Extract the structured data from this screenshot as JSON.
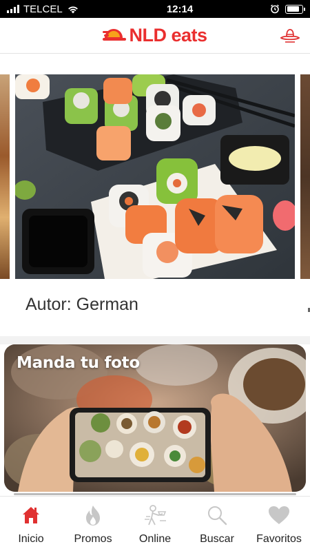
{
  "status_bar": {
    "carrier": "TELCEL",
    "time": "12:14",
    "battery_level": 0.85
  },
  "header": {
    "logo_text": "NLD eats",
    "brand_color": "#ea2f2f",
    "menu_icon": "sombrero-icon"
  },
  "feed": {
    "slide_image": "sushi-platter-photo",
    "author_label": "Autor: German"
  },
  "promo_card": {
    "title": "Manda tu foto",
    "image": "phone-photographing-food-photo"
  },
  "bottom_nav": {
    "active_color": "#e03131",
    "inactive_color": "#c7c7c7",
    "items": [
      {
        "label": "Inicio",
        "icon": "home-icon",
        "active": true
      },
      {
        "label": "Promos",
        "icon": "flame-icon",
        "active": false
      },
      {
        "label": "Online",
        "icon": "delivery-person-icon",
        "active": false
      },
      {
        "label": "Buscar",
        "icon": "search-icon",
        "active": false
      },
      {
        "label": "Favoritos",
        "icon": "heart-icon",
        "active": false
      }
    ]
  }
}
